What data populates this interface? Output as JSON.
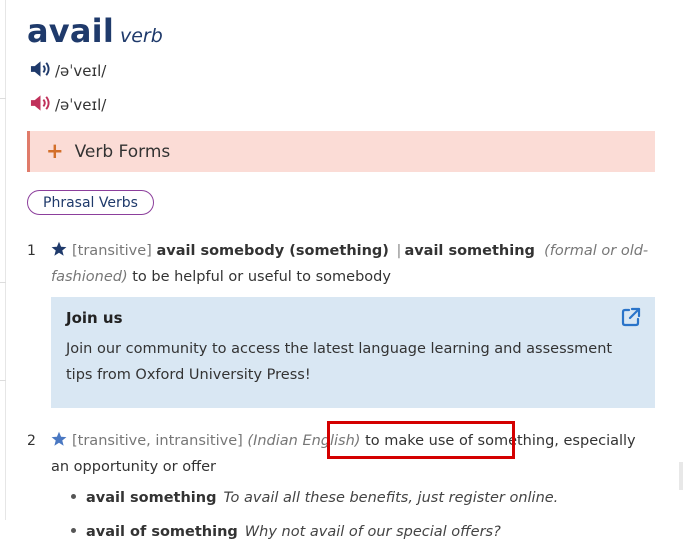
{
  "entry": {
    "headword": "avail",
    "pos": "verb"
  },
  "pronunciations": [
    {
      "region_color": "#1f3a6b",
      "ipa": "/əˈveɪl/",
      "icon": "speaker-icon"
    },
    {
      "region_color": "#c0305a",
      "ipa": "/əˈveɪl/",
      "icon": "speaker-icon"
    }
  ],
  "verb_forms": {
    "label": "Verb Forms",
    "icon": "plus-icon"
  },
  "phrasal_verbs": {
    "label": "Phrasal Verbs"
  },
  "senses": [
    {
      "num": "1",
      "grammar": "[transitive]",
      "cf1": "avail somebody (something)",
      "sep": "|",
      "cf2": "avail something",
      "labels": "(formal or old-fashioned)",
      "def": "to be helpful or useful to somebody"
    },
    {
      "num": "2",
      "grammar": "[transitive, intransitive]",
      "labels": "(Indian English)",
      "def_highlighted": "to make use of something,",
      "def_rest": "especially an opportunity or offer",
      "examples": [
        {
          "cf": "avail something",
          "text": "To avail all these benefits, just register online."
        },
        {
          "cf": "avail of something",
          "text": "Why not avail of our special offers?"
        }
      ]
    }
  ],
  "join_us": {
    "title": "Join us",
    "text": "Join our community to access the latest language learning and assessment tips from Oxford University Press!"
  },
  "colors": {
    "headword": "#1f3a6b",
    "verb_forms_bg": "#fbdcd6",
    "join_bg": "#d9e7f3",
    "highlight": "#d40000",
    "phrasal_border": "#8c3f9c"
  }
}
